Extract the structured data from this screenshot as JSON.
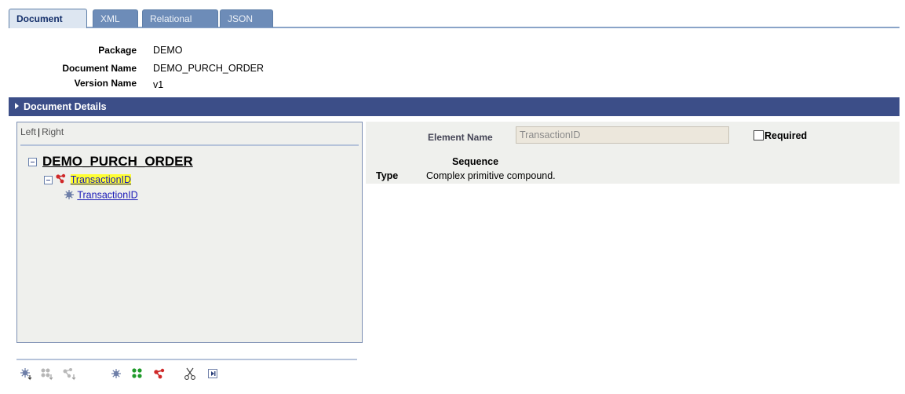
{
  "tabs": [
    {
      "label": "Document",
      "active": true
    },
    {
      "label": "XML",
      "active": false
    },
    {
      "label": "Relational",
      "active": false
    },
    {
      "label": "JSON",
      "active": false
    }
  ],
  "info": {
    "package_label": "Package",
    "package_value": "DEMO",
    "document_name_label": "Document Name",
    "document_name_value": "DEMO_PURCH_ORDER",
    "version_name_label": "Version Name",
    "version_name_value": "v1"
  },
  "section": {
    "title": "Document Details"
  },
  "tree": {
    "left_label": "Left",
    "separator": "|",
    "right_label": "Right",
    "root": "DEMO_PURCH_ORDER",
    "child": "TransactionID",
    "leaf": "TransactionID"
  },
  "detail": {
    "element_name_label": "Element Name",
    "element_name_value": "TransactionID",
    "required_label": "Required",
    "required_checked": false,
    "sequence_label": "Sequence",
    "type_label": "Type",
    "type_value": "Complex primitive compound."
  },
  "toolbar": {
    "icons": [
      "add-primitive-icon",
      "add-collection-icon",
      "add-compound-icon",
      "insert-primitive-icon",
      "insert-collection-icon",
      "insert-compound-icon",
      "cut-icon",
      "move-icon"
    ]
  },
  "colors": {
    "section_bar": "#3c4e88",
    "tab_inactive": "#6d8cb8",
    "panel_bg": "#eff0ed",
    "link": "#1a1ab8",
    "highlight": "#ffff33"
  }
}
